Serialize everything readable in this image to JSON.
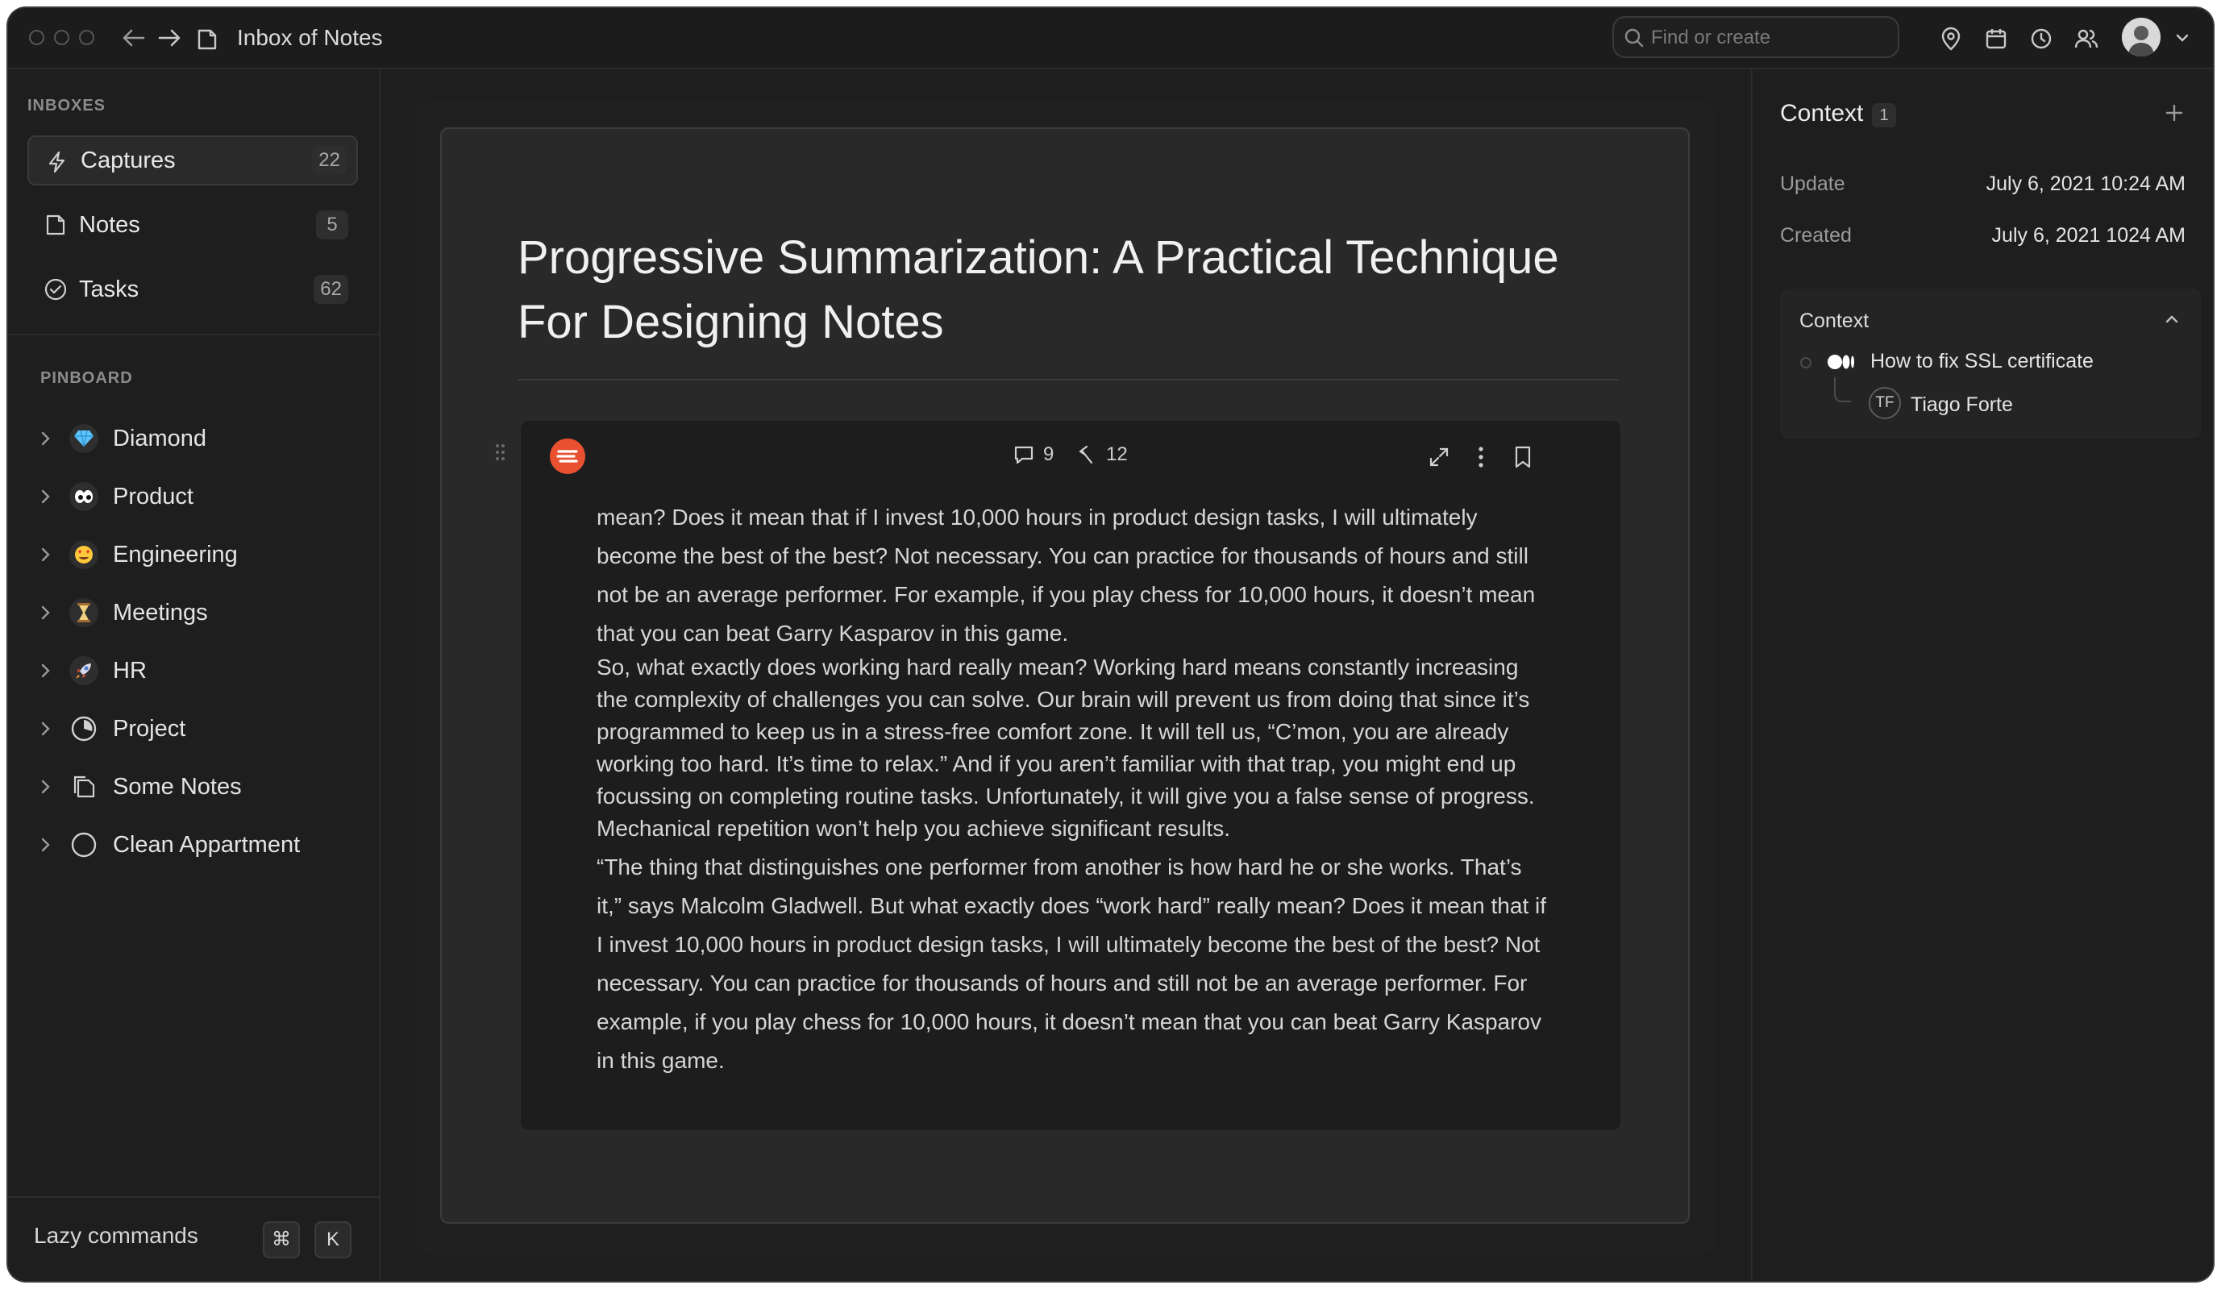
{
  "window": {
    "breadcrumb": "Inbox of Notes",
    "search_placeholder": "Find or create",
    "top_icons": [
      "pin-icon",
      "calendar-icon",
      "clock-icon",
      "people-icon"
    ]
  },
  "sidebar": {
    "inboxes_label": "INBOXES",
    "inboxes": [
      {
        "label": "Captures",
        "count": "22",
        "icon": "lightning-icon"
      },
      {
        "label": "Notes",
        "count": "5",
        "icon": "note-icon"
      },
      {
        "label": "Tasks",
        "count": "62",
        "icon": "check-circle-icon"
      }
    ],
    "pinboard_label": "PINBOARD",
    "pinboard": [
      {
        "label": "Diamond",
        "icon": "diamond-icon"
      },
      {
        "label": "Product",
        "icon": "eyes-icon"
      },
      {
        "label": "Engineering",
        "icon": "heart-eyes-icon"
      },
      {
        "label": "Meetings",
        "icon": "hourglass-icon"
      },
      {
        "label": "HR",
        "icon": "rocket-icon"
      },
      {
        "label": "Project",
        "icon": "pie-icon"
      },
      {
        "label": "Some Notes",
        "icon": "notes-icon"
      },
      {
        "label": "Clean Appartment",
        "icon": "circle-icon"
      }
    ],
    "lazy_commands": "Lazy commands",
    "shortcut_mod": "⌘",
    "shortcut_key": "K"
  },
  "document": {
    "title": "Progressive Summarization: A Practical Technique For Designing Notes",
    "card": {
      "comments": "9",
      "links": "12",
      "paragraphs_loose_1": "mean? Does it mean that if I invest 10,000 hours in product design tasks, I will ultimately become the best of the best? Not necessary. You can practice for thousands of hours and still not be an average performer. For example, if you play chess for 10,000 hours, it doesn’t mean that you can beat Garry Kasparov in this game.",
      "paragraph_tight_1": "So, what exactly does working hard really mean? Working hard means constantly increasing the complexity of challenges you can solve. Our brain will prevent us from doing that since it’s programmed to keep us in a stress-free comfort zone. It will tell us, “C’mon, you are already working too hard. It’s time to relax.” And if you aren’t familiar with that trap, you might end up focussing on completing routine tasks. Unfortunately, it will give you a false sense of progress.",
      "paragraph_tight_2": "Mechanical repetition won’t help you achieve significant results.",
      "paragraphs_loose_2": "“The thing that distinguishes one performer from another is how hard he or she works. That’s it,” says Malcolm Gladwell. But what exactly does “work hard” really mean? Does it mean that if I invest 10,000 hours in product design tasks, I will ultimately become the best of the best? Not necessary. You can practice for thousands of hours and still not be an average performer. For example, if you play chess for 10,000 hours, it doesn’t mean that you can beat Garry Kasparov in this game."
    }
  },
  "context_panel": {
    "title": "Context",
    "count": "1",
    "update_label": "Update",
    "update_value": "July 6, 2021 10:24 AM",
    "created_label": "Created",
    "created_value": "July 6, 2021 1024 AM",
    "box_title": "Context",
    "item": "How to fix SSL certificate",
    "author_initials": "TF",
    "author": "Tiago Forte"
  }
}
